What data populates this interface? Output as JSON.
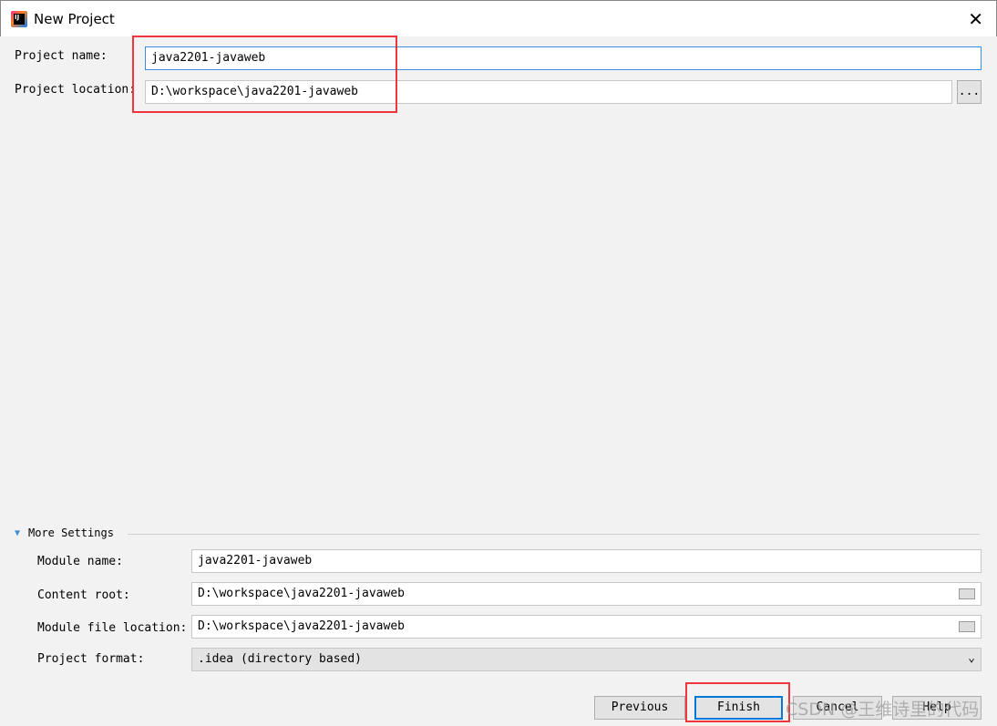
{
  "window": {
    "title": "New Project",
    "app_icon": "intellij-idea-icon",
    "close_icon": "close-icon"
  },
  "project": {
    "name_label": "Project name:",
    "name_value": "java2201-javaweb",
    "location_label": "Project location:",
    "location_value": "D:\\workspace\\java2201-javaweb",
    "browse_label": "..."
  },
  "more_settings": {
    "label": "More Settings",
    "expanded": true,
    "module_name_label": "Module name:",
    "module_name_value": "java2201-javaweb",
    "content_root_label": "Content root:",
    "content_root_value": "D:\\workspace\\java2201-javaweb",
    "module_file_label": "Module file location:",
    "module_file_value": "D:\\workspace\\java2201-javaweb",
    "format_label": "Project format:",
    "format_value": ".idea (directory based)"
  },
  "buttons": {
    "previous": "Previous",
    "finish": "Finish",
    "cancel": "Cancel",
    "help": "Help"
  },
  "highlight_color": "#f0363c",
  "watermark": "CSDN @王维诗里的代码"
}
